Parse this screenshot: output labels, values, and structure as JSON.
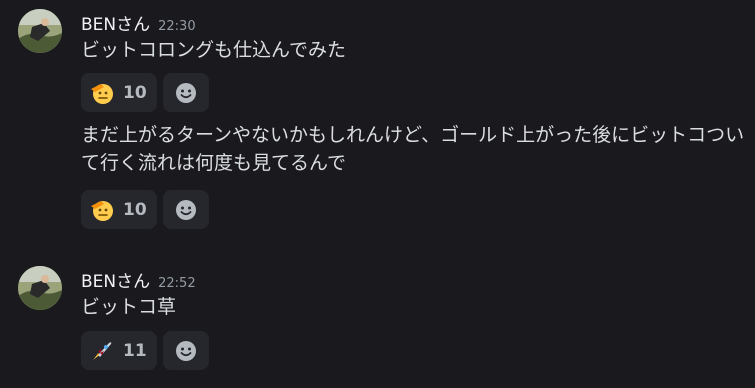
{
  "messages": [
    {
      "username": "BENさん",
      "timestamp": "22:30",
      "lines": [
        {
          "text": "ビットコロングも仕込んでみた",
          "reaction": {
            "emoji": "saluting-face",
            "count": "10"
          }
        },
        {
          "text": "まだ上がるターンやないかもしれんけど、ゴールド上がった後にビットコついて行く流れは何度も見てるんで",
          "reaction": {
            "emoji": "saluting-face",
            "count": "10"
          }
        }
      ]
    },
    {
      "username": "BENさん",
      "timestamp": "22:52",
      "lines": [
        {
          "text": "ビットコ草",
          "reaction": {
            "emoji": "rocket",
            "count": "11"
          }
        }
      ]
    }
  ],
  "colors": {
    "background": "#1a1a1e",
    "reaction_bg": "#26272c",
    "username": "#f2f3f5",
    "text": "#dbdee1",
    "timestamp": "#949ba4"
  }
}
